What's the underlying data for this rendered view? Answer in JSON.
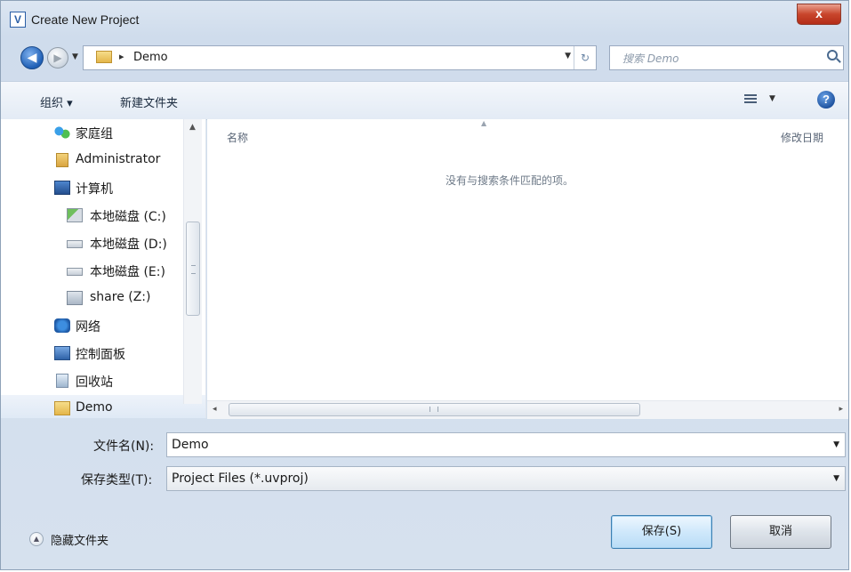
{
  "window": {
    "title": "Create New Project",
    "close_glyph": "x"
  },
  "nav": {
    "back_glyph": "◀",
    "forward_glyph": "▶",
    "address_arrow": "▸",
    "address_text": "Demo",
    "search_placeholder": "搜索 Demo",
    "refresh_glyph": "↻"
  },
  "toolbar": {
    "organize": "组织 ▾",
    "new_folder": "新建文件夹",
    "help_glyph": "?"
  },
  "sidebar": {
    "items": [
      {
        "label": "家庭组"
      },
      {
        "label": "Administrator"
      },
      {
        "label": "计算机"
      },
      {
        "label": "本地磁盘 (C:)"
      },
      {
        "label": "本地磁盘 (D:)"
      },
      {
        "label": "本地磁盘 (E:)"
      },
      {
        "label": "share (Z:)"
      },
      {
        "label": "网络"
      },
      {
        "label": "控制面板"
      },
      {
        "label": "回收站"
      },
      {
        "label": "Demo"
      }
    ]
  },
  "content": {
    "col_name": "名称",
    "col_date": "修改日期",
    "empty_message": "没有与搜索条件匹配的项。"
  },
  "form": {
    "filename_label": "文件名(N):",
    "filename_value": "Demo",
    "filetype_label": "保存类型(T):",
    "filetype_value": "Project Files (*.uvproj)"
  },
  "footer": {
    "hide_folders": "隐藏文件夹",
    "save_button": "保存(S)",
    "cancel_button": "取消"
  }
}
